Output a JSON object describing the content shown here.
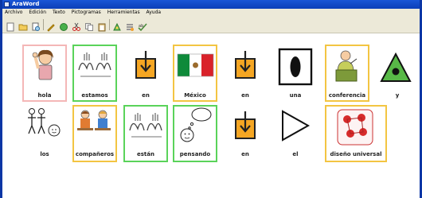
{
  "window": {
    "title": "AraWord"
  },
  "menu": [
    "Archivo",
    "Edición",
    "Texto",
    "Pictogramas",
    "Herramientas",
    "Ayuda"
  ],
  "toolbar": {
    "icons": [
      "new-document-icon",
      "open-folder-icon",
      "print-preview-icon",
      "pencil-icon",
      "globe-icon",
      "cut-icon",
      "copy-icon",
      "paste-icon",
      "pictogram-settings-icon",
      "list-settings-icon",
      "spell-check-icon"
    ]
  },
  "pictograms": [
    {
      "label": "hola",
      "border": "pink"
    },
    {
      "label": "estamos",
      "border": "green"
    },
    {
      "label": "en",
      "border": "none"
    },
    {
      "label": "México",
      "border": "yellow"
    },
    {
      "label": "en",
      "border": "none"
    },
    {
      "label": "una",
      "border": "none"
    },
    {
      "label": "conferencia",
      "border": "yellow"
    },
    {
      "label": "y",
      "border": "none"
    },
    {
      "label": "los",
      "border": "none"
    },
    {
      "label": "compañeros",
      "border": "yellow"
    },
    {
      "label": "están",
      "border": "green"
    },
    {
      "label": "pensando",
      "border": "green"
    },
    {
      "label": "en",
      "border": "none"
    },
    {
      "label": "el",
      "border": "none"
    },
    {
      "label": "diseño universal",
      "border": "yellow"
    }
  ]
}
